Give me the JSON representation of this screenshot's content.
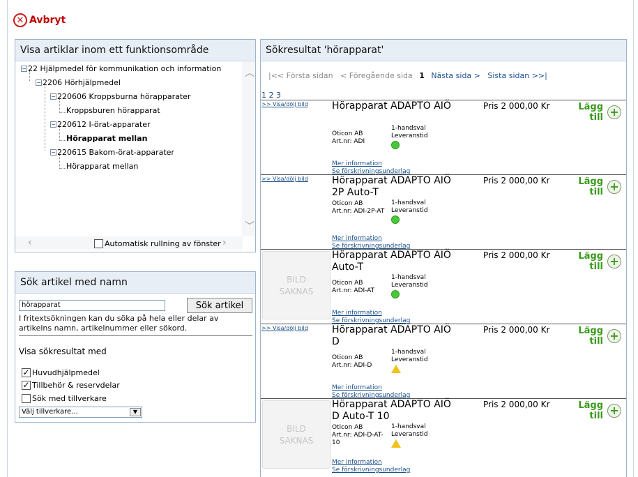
{
  "cancel": {
    "label": "Avbryt"
  },
  "tree_panel": {
    "title": "Visa artiklar inom ett funktionsområde",
    "nodes": [
      "22 Hjälpmedel för kommunikation och information",
      "2206 Hörhjälpmedel",
      "220606 Kroppsburna hörapparater",
      "Kroppsburen hörapparat",
      "220612 I-örat-apparater",
      "Hörapparat mellan",
      "220615 Bakom-örat-apparater",
      "Hörapparat mellan"
    ],
    "auto_scroll_label": "Automatisk rullning av fönster"
  },
  "search_panel": {
    "title": "Sök artikel med namn",
    "query": "hörapparat",
    "button_label": "Sök artikel",
    "hint": "I fritextsökningen kan du söka på hela eller delar av artikelns namn, artikelnummer eller sökord.",
    "show_results_with": "Visa sökresultat med",
    "options": [
      {
        "label": "Huvudhjälpmedel",
        "checked": true
      },
      {
        "label": "Tillbehör & reservdelar",
        "checked": true
      },
      {
        "label": "Sök med tillverkare",
        "checked": false
      }
    ],
    "manufacturer_select": "Välj tillverkare..."
  },
  "results_panel": {
    "title": "Sökresultat 'hörapparat'",
    "pager": {
      "first": "|<< Första sidan",
      "prev": "< Föregående sida",
      "current": "1",
      "next": "Nästa sida >",
      "last": "Sista sidan >>|"
    },
    "page_numbers": "1 2 3",
    "toggle_image": ">> Visa/dölj bild",
    "no_image": "BILD SAKNAS",
    "more_info": "Mer information",
    "prescription": "Se förskrivningsunderlag",
    "add_label": "Lägg till",
    "items": [
      {
        "title": "Hörapparat ADAPTO AIÖ",
        "vendor": "Oticon AB",
        "artnr": "Art.nr: ADI",
        "delivery": "1-handsval Leveranstid",
        "status": "green",
        "price": "Pris 2 000,00 Kr",
        "has_image": true
      },
      {
        "title": "Hörapparat ADAPTO AIÖ 2P Auto-T",
        "vendor": "Oticon AB",
        "artnr": "Art.nr: ADI-2P-AT",
        "delivery": "1-handsval Leveranstid",
        "status": "green",
        "price": "Pris 2 000,00 Kr",
        "has_image": true
      },
      {
        "title": "Hörapparat ADAPTO AIÖ Auto-T",
        "vendor": "Oticon AB",
        "artnr": "Art.nr: ADI-AT",
        "delivery": "1-handsval Leveranstid",
        "status": "green",
        "price": "Pris 2 000,00 Kr",
        "has_image": false
      },
      {
        "title": "Hörapparat ADAPTO AIÖ D",
        "vendor": "Oticon AB",
        "artnr": "Art.nr: ADI-D",
        "delivery": "1-handsval Leveranstid",
        "status": "yellow",
        "price": "Pris 2 000,00 Kr",
        "has_image": true
      },
      {
        "title": "Hörapparat ADAPTO AIÖ D Auto-T 10",
        "vendor": "Oticon AB",
        "artnr": "Art.nr: ADI-D-AT-10",
        "delivery": "1-handsval Leveranstid",
        "status": "yellow",
        "price": "Pris 2 000,00 Kr",
        "has_image": false
      }
    ]
  }
}
